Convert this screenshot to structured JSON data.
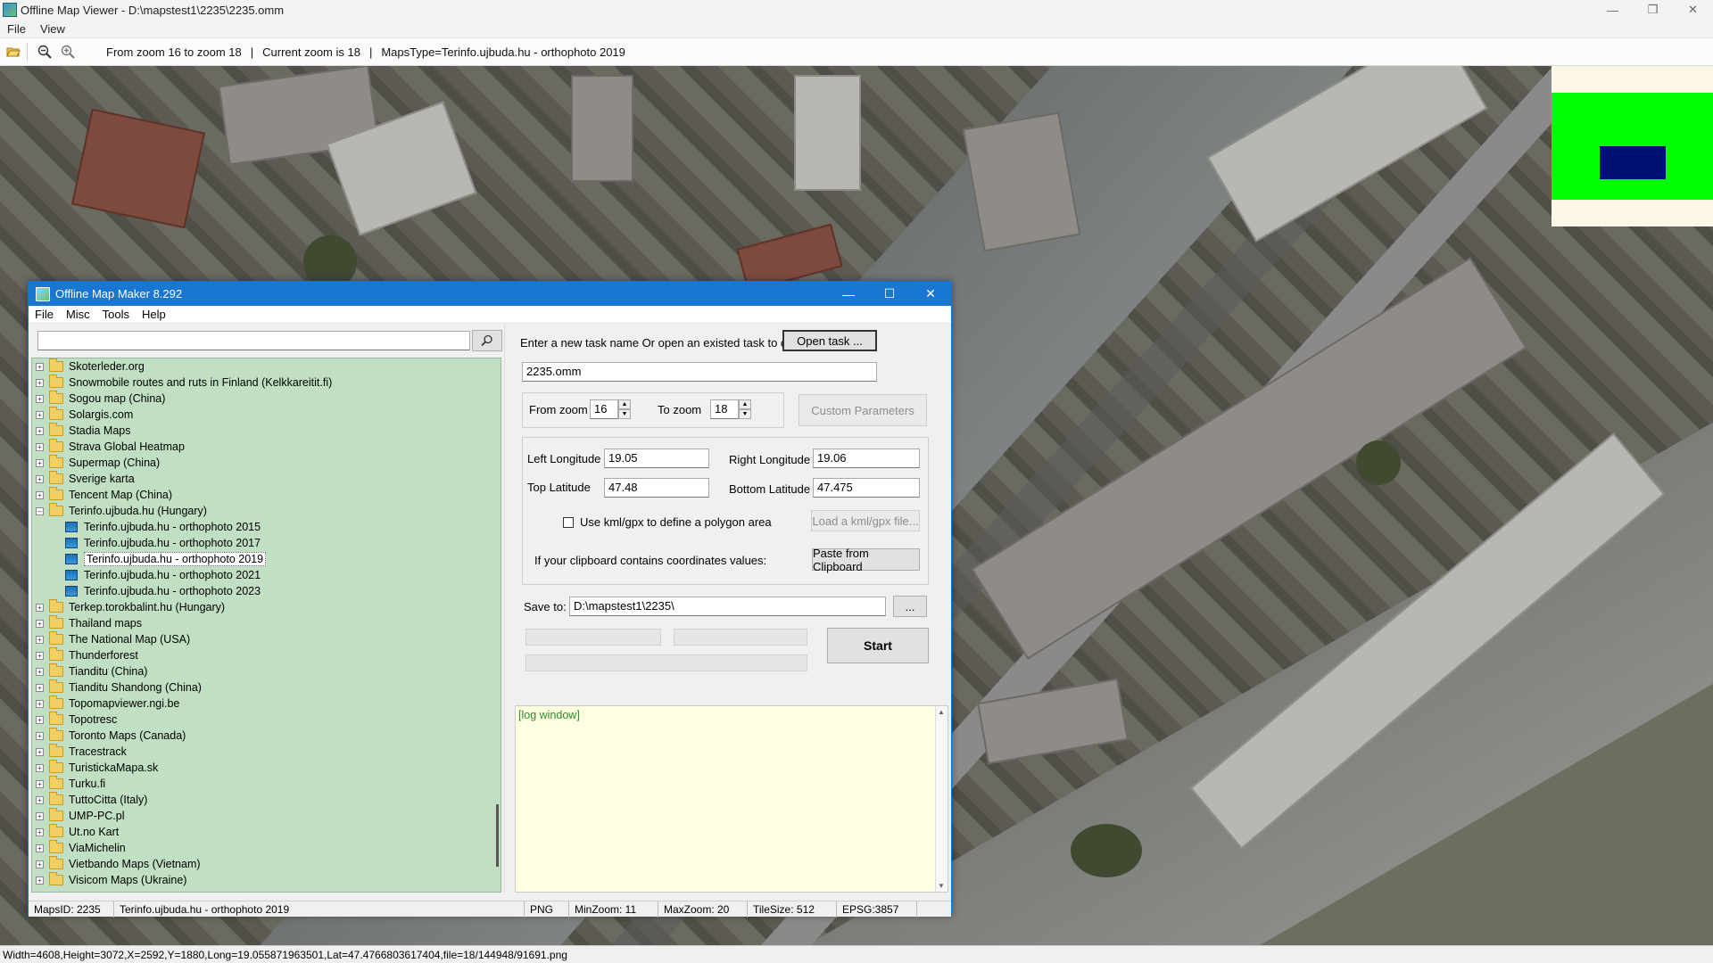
{
  "viewer": {
    "title": "Offline Map Viewer - D:\\mapstest1\\2235\\2235.omm",
    "menu": [
      "File",
      "View"
    ],
    "toolbar_info": {
      "zoom_range": "From zoom 16 to zoom 18",
      "current_zoom": "Current zoom is 18",
      "maps_type": "MapsType=Terinfo.ujbuda.hu - orthophoto 2019",
      "separator": "|"
    },
    "icons": {
      "open": "folder-open-icon",
      "zoom_out": "zoom-out-icon",
      "zoom_in": "zoom-in-icon"
    },
    "status": "Width=4608,Height=3072,X=2592,Y=1880,Long=19.055871963501,Lat=47.4766803617404,file=18/144948/91691.png",
    "minimap_colors": {
      "background": "#fbf6e6",
      "extent": "#00ff00",
      "view": "#001075"
    }
  },
  "map_maker": {
    "title": "Offline Map Maker 8.292",
    "menu": [
      "File",
      "Misc",
      "Tools",
      "Help"
    ],
    "search": {
      "value": "",
      "icon": "search-icon"
    },
    "tree": {
      "before": [
        "Skoterleder.org",
        "Snowmobile routes and ruts in Finland (Kelkkareitit.fi)",
        "Sogou map (China)",
        "Solargis.com",
        "Stadia Maps",
        "Strava Global Heatmap",
        "Supermap (China)",
        "Sverige karta",
        "Tencent Map (China)"
      ],
      "expanded": {
        "label": "Terinfo.ujbuda.hu (Hungary)",
        "children": [
          "Terinfo.ujbuda.hu - orthophoto 2015",
          "Terinfo.ujbuda.hu - orthophoto 2017",
          "Terinfo.ujbuda.hu - orthophoto 2019",
          "Terinfo.ujbuda.hu - orthophoto 2021",
          "Terinfo.ujbuda.hu - orthophoto 2023"
        ],
        "selected_index": 2
      },
      "after": [
        "Terkep.torokbalint.hu (Hungary)",
        "Thailand maps",
        "The National Map (USA)",
        "Thunderforest",
        "Tianditu (China)",
        "Tianditu Shandong (China)",
        "Topomapviewer.ngi.be",
        "Topotresc",
        "Toronto Maps (Canada)",
        "Tracestrack",
        "TuristickaMapa.sk",
        "Turku.fi",
        "TuttoCitta (Italy)",
        "UMP-PC.pl",
        "Ut.no Kart",
        "ViaMichelin",
        "Vietbando Maps (Vietnam)",
        "Visicom Maps (Ukraine)"
      ]
    },
    "form": {
      "task_prompt": "Enter a new task name Or open an existed task to continue:",
      "open_task_button": "Open task ...",
      "task_name": "2235.omm",
      "from_zoom_label": "From zoom",
      "from_zoom_value": "16",
      "to_zoom_label": "To zoom",
      "to_zoom_value": "18",
      "custom_params_button": "Custom Parameters",
      "left_longitude_label": "Left Longitude",
      "left_longitude": "19.05",
      "right_longitude_label": "Right Longitude",
      "right_longitude": "19.06",
      "top_latitude_label": "Top Latitude",
      "top_latitude": "47.48",
      "bottom_latitude_label": "Bottom Latitude",
      "bottom_latitude": "47.475",
      "kml_checkbox_label": "Use kml/gpx to define a polygon area",
      "load_kml_button": "Load a kml/gpx file...",
      "clipboard_prompt": "If your clipboard contains coordinates values:",
      "paste_button": "Paste from Clipboard",
      "save_to_label": "Save to:",
      "save_to_value": "D:\\mapstest1\\2235\\",
      "browse_button": "...",
      "start_button": "Start",
      "log_text": "[log window]"
    },
    "status": {
      "maps_id": "MapsID: 2235",
      "maps_name": "Terinfo.ujbuda.hu - orthophoto 2019",
      "format": "PNG",
      "min_zoom": "MinZoom: 11",
      "max_zoom": "MaxZoom: 20",
      "tile_size": "TileSize: 512",
      "epsg": "EPSG:3857"
    }
  }
}
